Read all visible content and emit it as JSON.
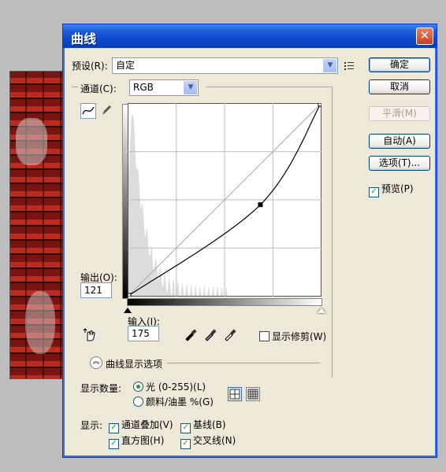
{
  "dialog": {
    "title": "曲线",
    "close_glyph": "✕"
  },
  "preset": {
    "label": "预设(R):",
    "value": "自定"
  },
  "channel": {
    "label": "通道(C):",
    "value": "RGB"
  },
  "buttons": {
    "ok": "确定",
    "cancel": "取消",
    "smooth": "平滑(M)",
    "auto": "自动(A)",
    "options": "选项(T)...",
    "preview": "预览(P)"
  },
  "preview_checked": true,
  "output": {
    "label": "输出(O):",
    "value": "121"
  },
  "input": {
    "label": "输入(I):",
    "value": "175"
  },
  "show_clipping": {
    "label": "显示修剪(W)",
    "checked": false
  },
  "curve_options": {
    "section_label": "曲线显示选项",
    "amount_label": "显示数量:",
    "light_option": "光 (0-255)(L)",
    "pigment_option": "颜料/油墨 %(G)",
    "light_selected": true,
    "show_label": "显示:",
    "channel_overlays": "通道叠加(V)",
    "baseline": "基线(B)",
    "histogram": "直方图(H)",
    "intersection": "交叉线(N)",
    "channel_overlays_checked": true,
    "baseline_checked": true,
    "histogram_checked": true,
    "intersection_checked": true
  },
  "icons": {
    "curve_tool": "curve-tool-icon",
    "pencil_tool": "pencil-icon",
    "hand_adjust": "hand-adjust-icon",
    "eyedropper_black": "eyedropper-black-icon",
    "eyedropper_gray": "eyedropper-gray-icon",
    "eyedropper_white": "eyedropper-white-icon",
    "grid_coarse": "grid-4x4-icon",
    "grid_fine": "grid-10x10-icon",
    "preset_menu": "preset-options-icon"
  },
  "chart_data": {
    "type": "line",
    "xlim": [
      0,
      255
    ],
    "ylim": [
      0,
      255
    ],
    "grid": "4x4",
    "baseline": [
      [
        0,
        0
      ],
      [
        255,
        255
      ]
    ],
    "curve_points": [
      [
        0,
        0
      ],
      [
        175,
        121
      ],
      [
        255,
        255
      ]
    ],
    "selected_point": [
      175,
      121
    ]
  }
}
